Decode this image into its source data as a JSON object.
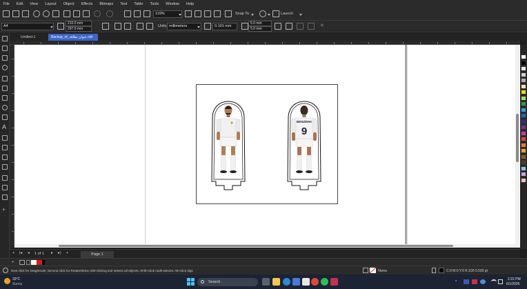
{
  "menu": [
    "File",
    "Edit",
    "View",
    "Layout",
    "Object",
    "Effects",
    "Bitmaps",
    "Text",
    "Table",
    "Tools",
    "Window",
    "Help"
  ],
  "toolbar": {
    "zoom": "119%",
    "snap_to": "Snap To",
    "launch": "Launch"
  },
  "property_bar": {
    "page_size": "A4",
    "width": "210.0 mm",
    "height": "297.0 mm",
    "units_label": "Units:",
    "units": "millimeters",
    "nudge": "0.101 mm",
    "dup_x": "5.0 mm",
    "dup_y": "5.0 mm"
  },
  "tabs": [
    {
      "label": "Untitled-1",
      "active": false
    },
    {
      "label": "Backup_of_عنوان بطاقة.cdr",
      "active": true
    }
  ],
  "ruler_unit": "millimeters",
  "players": [
    {
      "name": "",
      "number": "",
      "view": "front"
    },
    {
      "name": "BENZEMA",
      "number": "9",
      "view": "back"
    }
  ],
  "page_nav": {
    "counter": "1 of 1",
    "page_tab": "Page 1"
  },
  "status": {
    "hint": "Next click for Drag/Scale; Second click for Rotate/Skew; Dbl-clicking tool selects all objects; Shift+click multi-selects; Alt+click digs",
    "fill": "None",
    "outline": "C:0 M:0 Y:0 K:100  0.500 pt"
  },
  "taskbar": {
    "weather_temp": "33°C",
    "weather_text": "Sunny",
    "search": "Search",
    "time": "2:22 PM",
    "date": "6/1/2026"
  },
  "colors": {
    "accent": "#3c66c8",
    "palette": [
      "#ffffff",
      "#000000",
      "#e8e8e8",
      "#d0d0d0",
      "#b0b0b0",
      "#f3e6a0",
      "#f6d800",
      "#a8d86a",
      "#2f9a3c",
      "#23a4d8",
      "#1c64c8",
      "#2a2a8c",
      "#7a2a8c",
      "#c83ca0",
      "#e83c3c",
      "#e8782a",
      "#f0a020",
      "#8a5a2a",
      "#5a3a1a",
      "#7ac8e8",
      "#c8a0d8",
      "#f0c0c0"
    ]
  }
}
